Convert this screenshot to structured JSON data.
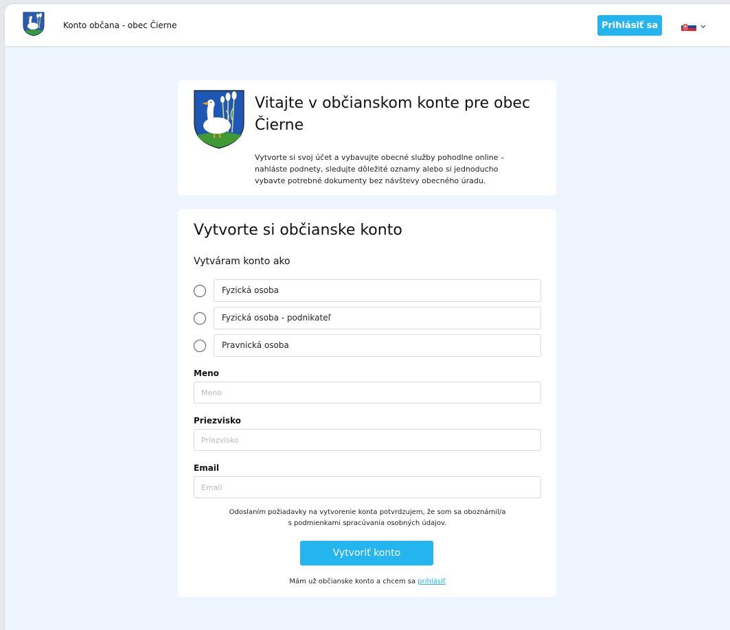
{
  "header": {
    "title": "Konto občana - obec Čierne",
    "login_label": "Prihlásiť sa",
    "language_flag": "slovak-flag-icon",
    "accent": "#24b5ee"
  },
  "welcome": {
    "title": "Vitajte v občianskom konte pre obec Čierne",
    "text": "Vytvorte si svoj účet a vybavujte obecné služby pohodlne online – nahláste podnety, sledujte dôležité oznamy alebo si jednoducho vybavte potrebné dokumenty bez návštevy obecného úradu."
  },
  "form": {
    "title": "Vytvorte si občianske konto",
    "subtitle": "Vytváram konto ako",
    "options": [
      {
        "label": "Fyzická osoba"
      },
      {
        "label": "Fyzická osoba - podnikateľ"
      },
      {
        "label": "Pravnická osoba"
      }
    ],
    "fields": {
      "meno": {
        "label": "Meno",
        "placeholder": "Meno",
        "value": ""
      },
      "priezvisko": {
        "label": "Priezvisko",
        "placeholder": "Priezvisko",
        "value": ""
      },
      "email": {
        "label": "Email",
        "placeholder": "Email",
        "value": ""
      }
    },
    "consent_line1": "Odoslaním požiadavky na vytvorenie konta potvrdzujem, že som sa oboznámil/a",
    "consent_line2": "s podmienkami spracúvania osobných údajov.",
    "submit_label": "Vytvoriť konto",
    "login_prompt": "Mám už občianske konto a chcem sa",
    "login_link": "prihlásiť"
  }
}
